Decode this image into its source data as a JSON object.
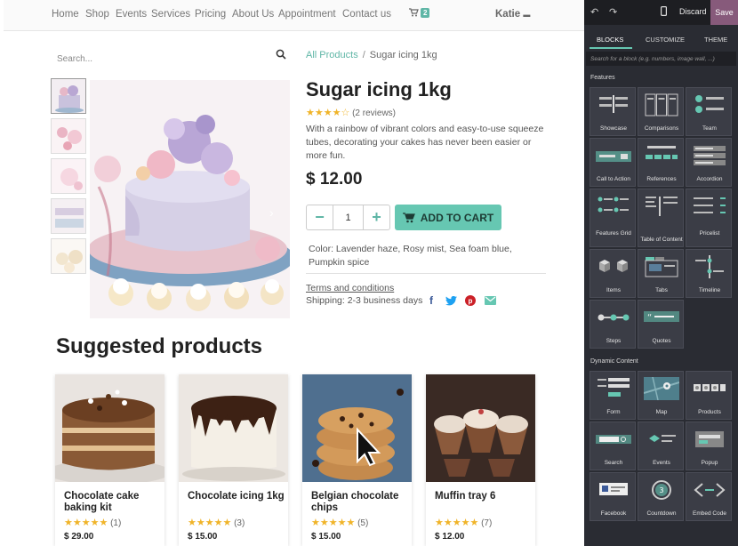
{
  "nav": {
    "links": [
      "Home",
      "Shop",
      "Events",
      "Services",
      "Pricing",
      "About Us",
      "Appointment",
      "Contact us"
    ],
    "cart_count": "2",
    "user": "Katie"
  },
  "search": {
    "placeholder": "Search..."
  },
  "breadcrumb": {
    "parent": "All Products",
    "separator": "/",
    "current": "Sugar icing 1kg"
  },
  "product": {
    "title": "Sugar icing 1kg",
    "reviews": "(2 reviews)",
    "description": "With a rainbow of vibrant colors and easy-to-use squeeze tubes, decorating your cakes has never been easier or more fun.",
    "price": "$ 12.00",
    "quantity": "1",
    "add_to_cart": "ADD TO CART",
    "variants": "Color: Lavender haze, Rosy mist, Sea foam blue, Pumpkin spice",
    "terms": "Terms and conditions",
    "shipping": "Shipping: 2-3 business days"
  },
  "suggested": {
    "title": "Suggested products",
    "items": [
      {
        "name": "Chocolate cake baking kit",
        "rating_count": "(1)",
        "price": "$ 29.00"
      },
      {
        "name": "Chocolate icing 1kg",
        "rating_count": "(3)",
        "price": "$ 15.00"
      },
      {
        "name": "Belgian chocolate chips",
        "rating_count": "(5)",
        "price": "$ 15.00"
      },
      {
        "name": "Muffin tray 6",
        "rating_count": "(7)",
        "price": "$ 12.00"
      }
    ]
  },
  "editor": {
    "discard": "Discard",
    "save": "Save",
    "tabs": [
      "BLOCKS",
      "CUSTOMIZE",
      "THEME"
    ],
    "search_placeholder": "Search for a block (e.g. numbers, image wall, ...)",
    "features_label": "Features",
    "features": [
      "Showcase",
      "Comparisons",
      "Team",
      "Call to Action",
      "References",
      "Accordion",
      "Features Grid",
      "Table of Content",
      "Pricelist",
      "Items",
      "Tabs",
      "Timeline",
      "Steps",
      "Quotes"
    ],
    "dynamic_label": "Dynamic Content",
    "dynamic": [
      "Form",
      "Map",
      "Products",
      "Search",
      "Events",
      "Popup",
      "Facebook",
      "Countdown",
      "Embed Code"
    ]
  },
  "colors": {
    "accent": "#66c7b2",
    "save": "#875a7b",
    "panel": "#2a2c33",
    "star": "#f0b429"
  }
}
